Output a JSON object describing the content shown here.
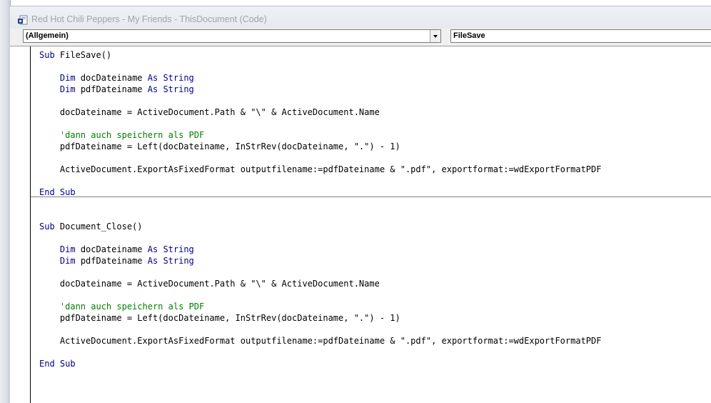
{
  "window": {
    "title": "Red Hot Chili Peppers - My Friends - ThisDocument (Code)"
  },
  "object_combo": {
    "value": "(Allgemein)"
  },
  "procedure_combo": {
    "value": "FileSave"
  },
  "code": {
    "procedures": [
      {
        "lines": [
          [
            {
              "t": "Sub",
              "c": "kw"
            },
            {
              "t": " FileSave()"
            }
          ],
          [],
          [
            {
              "t": "    "
            },
            {
              "t": "Dim",
              "c": "kw"
            },
            {
              "t": " docDateiname "
            },
            {
              "t": "As",
              "c": "kw"
            },
            {
              "t": " "
            },
            {
              "t": "String",
              "c": "kw"
            }
          ],
          [
            {
              "t": "    "
            },
            {
              "t": "Dim",
              "c": "kw"
            },
            {
              "t": " pdfDateiname "
            },
            {
              "t": "As",
              "c": "kw"
            },
            {
              "t": " "
            },
            {
              "t": "String",
              "c": "kw"
            }
          ],
          [],
          [
            {
              "t": "    docDateiname = ActiveDocument.Path & \"\\\" & ActiveDocument.Name"
            }
          ],
          [],
          [
            {
              "t": "    "
            },
            {
              "t": "'dann auch speichern als PDF",
              "c": "cm"
            }
          ],
          [
            {
              "t": "    pdfDateiname = Left(docDateiname, InStrRev(docDateiname, \".\") - 1)"
            }
          ],
          [],
          [
            {
              "t": "    ActiveDocument.ExportAsFixedFormat outputfilename:=pdfDateiname & \".pdf\", exportformat:=wdExportFormatPDF"
            }
          ],
          [],
          [
            {
              "t": "End Sub",
              "c": "kw"
            }
          ]
        ]
      },
      {
        "lines": [
          [],
          [],
          [
            {
              "t": "Sub",
              "c": "kw"
            },
            {
              "t": " Document_Close()"
            }
          ],
          [],
          [
            {
              "t": "    "
            },
            {
              "t": "Dim",
              "c": "kw"
            },
            {
              "t": " docDateiname "
            },
            {
              "t": "As",
              "c": "kw"
            },
            {
              "t": " "
            },
            {
              "t": "String",
              "c": "kw"
            }
          ],
          [
            {
              "t": "    "
            },
            {
              "t": "Dim",
              "c": "kw"
            },
            {
              "t": " pdfDateiname "
            },
            {
              "t": "As",
              "c": "kw"
            },
            {
              "t": " "
            },
            {
              "t": "String",
              "c": "kw"
            }
          ],
          [],
          [
            {
              "t": "    docDateiname = ActiveDocument.Path & \"\\\" & ActiveDocument.Name"
            }
          ],
          [],
          [
            {
              "t": "    "
            },
            {
              "t": "'dann auch speichern als PDF",
              "c": "cm"
            }
          ],
          [
            {
              "t": "    pdfDateiname = Left(docDateiname, InStrRev(docDateiname, \".\") - 1)"
            }
          ],
          [],
          [
            {
              "t": "    ActiveDocument.ExportAsFixedFormat outputfilename:=pdfDateiname & \".pdf\", exportformat:=wdExportFormatPDF"
            }
          ],
          [],
          [
            {
              "t": "End Sub",
              "c": "kw"
            }
          ]
        ]
      }
    ]
  },
  "colors": {
    "keyword": "#00008b",
    "comment": "#008000",
    "text": "#000000"
  },
  "icons": {
    "title_icon": "word-document-icon",
    "dropdown_icon": "chevron-down-icon"
  }
}
